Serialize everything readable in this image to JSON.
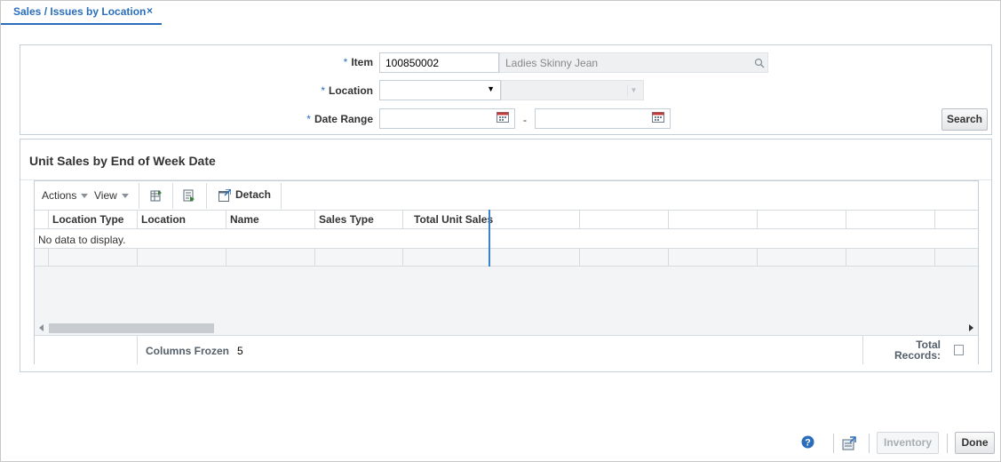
{
  "tab": {
    "label": "Sales / Issues by Location",
    "close_glyph": "×"
  },
  "search": {
    "item_label": "Item",
    "item_value": "100850002",
    "item_description": "Ladies Skinny Jean",
    "location_label": "Location",
    "location_value": "",
    "date_range_label": "Date Range",
    "date_from": "",
    "date_to": "",
    "date_separator": "-",
    "required_mark": "*",
    "search_button": "Search"
  },
  "results": {
    "title": "Unit Sales by End of Week Date",
    "toolbar": {
      "actions": "Actions",
      "view": "View",
      "detach": "Detach"
    },
    "columns": [
      "Location Type",
      "Location",
      "Name",
      "Sales Type",
      "Total Unit Sales"
    ],
    "empty_message": "No data to display.",
    "columns_frozen_label": "Columns Frozen",
    "columns_frozen_value": "5",
    "total_records_label_1": "Total",
    "total_records_label_2": "Records:"
  },
  "bottom": {
    "inventory_button": "Inventory",
    "done_button": "Done",
    "help_icon": "help-icon",
    "export_icon": "export-icon"
  },
  "colors": {
    "accent": "#2a6ebb",
    "border": "#c4ced7",
    "required_marker": "#f0761b"
  }
}
